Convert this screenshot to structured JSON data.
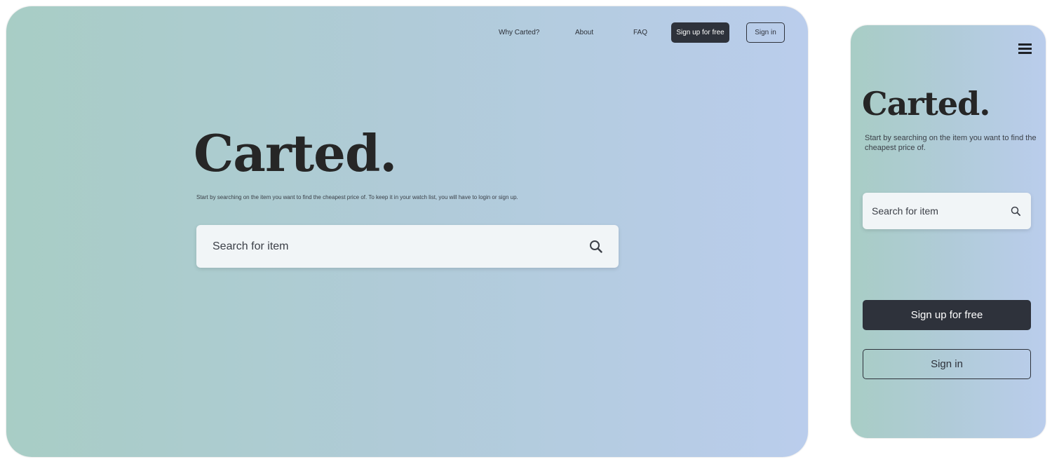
{
  "desktop": {
    "nav": {
      "why": "Why Carted?",
      "about": "About",
      "faq": "FAQ",
      "signup": "Sign up for free",
      "signin": "Sign in"
    },
    "logo": "Carted.",
    "tagline": "Start by searching on the item you want to find the cheapest price of. To keep it in your watch list, you will have to login or sign up.",
    "search_placeholder": "Search for item"
  },
  "mobile": {
    "logo": "Carted.",
    "tagline": "Start by searching on the item you want to find the cheapest price of.",
    "search_placeholder": "Search for item",
    "signup": "Sign up for free",
    "signin": "Sign in"
  },
  "colors": {
    "gradient_start": "#a8cdc5",
    "gradient_end": "#bacdec",
    "dark_button": "#2e323b",
    "search_bg": "#f1f5f7",
    "logo_text": "#262626"
  },
  "icons": [
    "search-icon",
    "hamburger-menu-icon"
  ]
}
